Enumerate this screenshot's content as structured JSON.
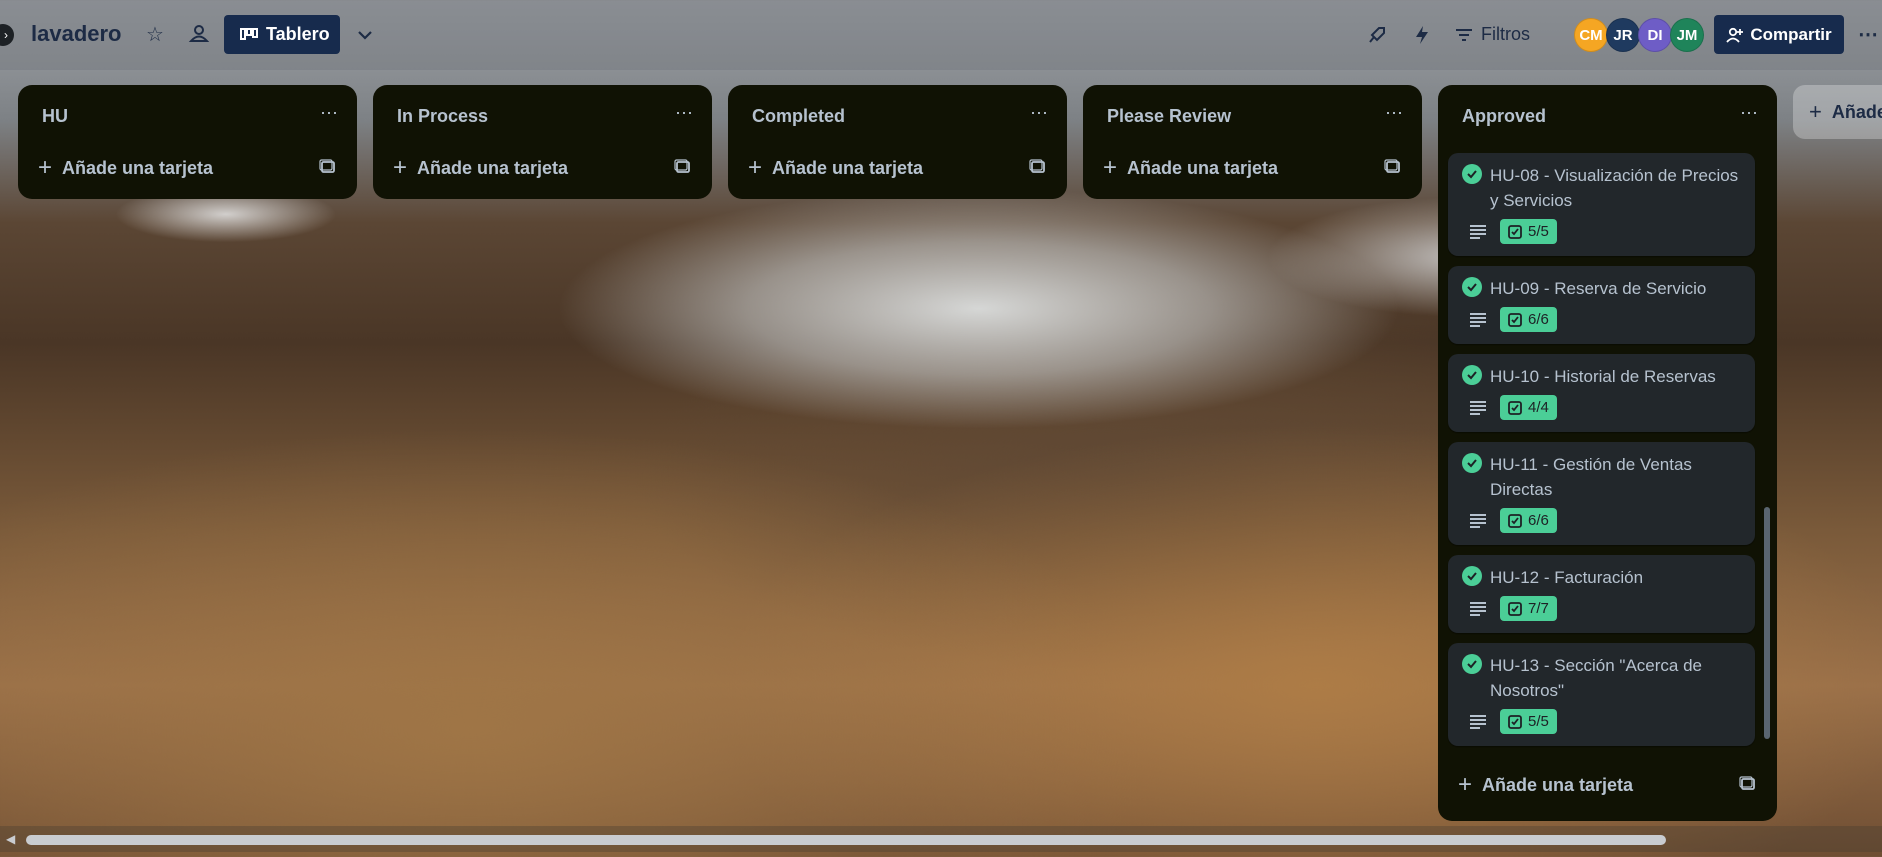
{
  "board": {
    "title": "lavadero",
    "view_label": "Tablero",
    "filter_label": "Filtros",
    "share_label": "Compartir"
  },
  "members": [
    {
      "initials": "CM",
      "color": "#f5a623"
    },
    {
      "initials": "JR",
      "color": "#1f3a5f"
    },
    {
      "initials": "DI",
      "color": "#6e5dc6"
    },
    {
      "initials": "JM",
      "color": "#1f845a"
    }
  ],
  "lists": [
    {
      "title": "HU",
      "add_label": "Añade una tarjeta"
    },
    {
      "title": "In Process",
      "add_label": "Añade una tarjeta"
    },
    {
      "title": "Completed",
      "add_label": "Añade una tarjeta"
    },
    {
      "title": "Please Review",
      "add_label": "Añade una tarjeta"
    },
    {
      "title": "Approved",
      "add_label": "Añade una tarjeta",
      "cards": [
        {
          "title": "HU-08 - Visualización de Precios y Servicios",
          "checklist": "5/5"
        },
        {
          "title": "HU-09 - Reserva de Servicio",
          "checklist": "6/6"
        },
        {
          "title": "HU-10 - Historial de Reservas",
          "checklist": "4/4"
        },
        {
          "title": "HU-11 - Gestión de Ventas Directas",
          "checklist": "6/6"
        },
        {
          "title": "HU-12 - Facturación",
          "checklist": "7/7"
        },
        {
          "title": "HU-13 - Sección \"Acerca de Nosotros\"",
          "checklist": "5/5"
        }
      ]
    }
  ],
  "add_list_label": "Añade"
}
